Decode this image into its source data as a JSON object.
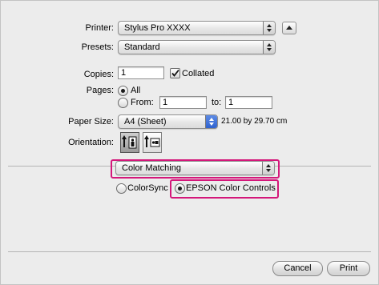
{
  "printer": {
    "label": "Printer:",
    "value": "Stylus Pro XXXX"
  },
  "presets": {
    "label": "Presets:",
    "value": "Standard"
  },
  "copies": {
    "label": "Copies:",
    "value": "1",
    "collated_label": "Collated",
    "collated_checked": true
  },
  "pages": {
    "label": "Pages:",
    "all_label": "All",
    "from_label": "From:",
    "from_value": "1",
    "to_label": "to:",
    "to_value": "1",
    "selected": "All"
  },
  "paper_size": {
    "label": "Paper Size:",
    "value": "A4 (Sheet)",
    "dimensions": "21.00 by 29.70 cm"
  },
  "orientation": {
    "label": "Orientation:",
    "selected": "portrait"
  },
  "panel": {
    "value": "Color Matching"
  },
  "color_mode": {
    "colorsync_label": "ColorSync",
    "epson_label": "EPSON Color Controls",
    "selected": "EPSON Color Controls"
  },
  "buttons": {
    "cancel": "Cancel",
    "print": "Print"
  },
  "colors": {
    "highlight": "#d4177a",
    "accent_blue": "#3a6fd8"
  }
}
